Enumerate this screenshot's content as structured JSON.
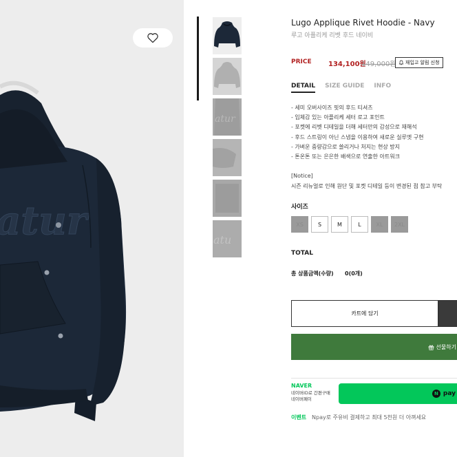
{
  "product": {
    "title": "Lugo Applique Rivet Hoodie - Navy",
    "subtitle": "루고 아플리케 리벳 후드 네이비",
    "price_label": "PRICE",
    "sale_price": "134,100원",
    "original_price": "149,000원",
    "restock_label": "재입고 알림 신청"
  },
  "tabs": [
    {
      "label": "DETAIL",
      "active": true
    },
    {
      "label": "SIZE GUIDE",
      "active": false
    },
    {
      "label": "INFO",
      "active": false
    }
  ],
  "details": [
    "- 세미 오버사이즈 핏의 후드 티셔츠",
    "- 입체감 있는 아플리케 세터 로고 포인트",
    "- 포켓에 리벳 디테일을 더해 세터만의 감성으로 재해석",
    "- 후드 스트링이 아닌 스냅을 이용하여 새로운 실루엣 구현",
    "- 가벼운 중량감으로 쓸리거나 처지는 현상 방지",
    "- 톤온톤 또는 은은한 배색으로 연출한 아트워크"
  ],
  "notice": {
    "title": "[Notice]",
    "text": "시즌 리뉴얼로 인해 원단 및 포켓 디테일 등이 변경된 점 참고 부탁"
  },
  "size": {
    "label": "사이즈",
    "options": [
      {
        "label": "XS",
        "soldout": true
      },
      {
        "label": "S",
        "soldout": false
      },
      {
        "label": "M",
        "soldout": false
      },
      {
        "label": "L",
        "soldout": false
      },
      {
        "label": "XL",
        "soldout": true
      },
      {
        "label": "2XL",
        "soldout": true
      }
    ]
  },
  "total": {
    "label": "TOTAL",
    "qty_label": "총 상품금액(수량)",
    "qty_value": "0(0개)"
  },
  "actions": {
    "cart_label": "카트에 담기",
    "gift_label": "선물하기"
  },
  "naver": {
    "logo": "NAVER",
    "desc_line1": "네이버ID로 간편구매",
    "desc_line2": "네이버페이",
    "npay_n": "N",
    "npay_label": "pay",
    "event_label": "이벤트",
    "event_text": "Npay로 주유비 결제하고 최대 5천원 더 아껴세요"
  },
  "colors": {
    "accent_red": "#b22222",
    "gift_green": "#3f7a3c",
    "naver_green": "#03c75a",
    "hoodie_navy": "#1c2838"
  },
  "icons": {
    "wishlist": "heart-icon",
    "restock": "bell-icon",
    "gift": "gift-icon"
  }
}
